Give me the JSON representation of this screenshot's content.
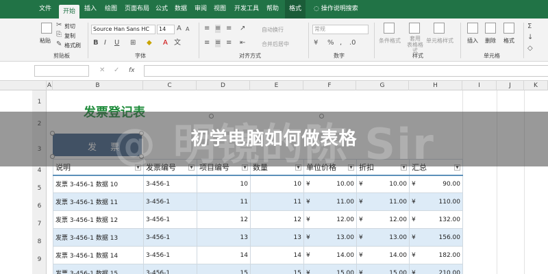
{
  "tabs": [
    "文件",
    "开始",
    "插入",
    "绘图",
    "页面布局",
    "公式",
    "数据",
    "审阅",
    "视图",
    "开发工具",
    "帮助",
    "格式"
  ],
  "tell_me": "操作说明搜索",
  "clipboard": {
    "paste": "粘贴",
    "cut": "剪切",
    "copy": "复制",
    "format_painter": "格式刷",
    "group": "剪贴板"
  },
  "font": {
    "name": "Source Han Sans HC",
    "size": "14",
    "group": "字体"
  },
  "alignment": {
    "wrap": "自动换行",
    "merge": "合并后居中",
    "group": "对齐方式"
  },
  "number": {
    "format": "常规",
    "group": "数字"
  },
  "styles": {
    "cond": "条件格式",
    "table": "套用\n表格格式",
    "cell": "单元格样式",
    "group": "样式"
  },
  "cells": {
    "insert": "插入",
    "delete": "删除",
    "format": "格式",
    "group": "单元格"
  },
  "formula_bar": {
    "fx": "fx"
  },
  "columns": [
    "A",
    "B",
    "C",
    "D",
    "E",
    "F",
    "G",
    "H",
    "I",
    "J",
    "K"
  ],
  "rows": [
    "1",
    "2",
    "3",
    "4",
    "5",
    "6",
    "7",
    "8",
    "9"
  ],
  "doc_title": "发票登记表",
  "shape_text": "发 票",
  "table": {
    "headers": [
      "说明",
      "发票编号",
      "项目编号",
      "数量",
      "单位价格",
      "折扣",
      "汇总"
    ],
    "currency": "¥",
    "rows": [
      [
        "发票 3-456-1 数据 10",
        "3-456-1",
        "10",
        "10",
        "10.00",
        "10.00",
        "90.00"
      ],
      [
        "发票 3-456-1 数据 11",
        "3-456-1",
        "11",
        "11",
        "11.00",
        "11.00",
        "110.00"
      ],
      [
        "发票 3-456-1 数据 12",
        "3-456-1",
        "12",
        "12",
        "12.00",
        "12.00",
        "132.00"
      ],
      [
        "发票 3-456-1 数据 13",
        "3-456-1",
        "13",
        "13",
        "13.00",
        "13.00",
        "156.00"
      ],
      [
        "发票 3-456-1 数据 14",
        "3-456-1",
        "14",
        "14",
        "14.00",
        "14.00",
        "182.00"
      ],
      [
        "发票 3-456-1 数据 15",
        "3-456-1",
        "15",
        "15",
        "15.00",
        "15.00",
        "210.00"
      ]
    ]
  },
  "overlay_title": "初学电脑如何做表格",
  "watermark": "@ 明镜的陈 Sir",
  "colors": {
    "excel_green": "#217346",
    "title_green": "#1f8c3b",
    "band_blue": "#ddebf7",
    "shape_blue": "#3d5f8a"
  }
}
